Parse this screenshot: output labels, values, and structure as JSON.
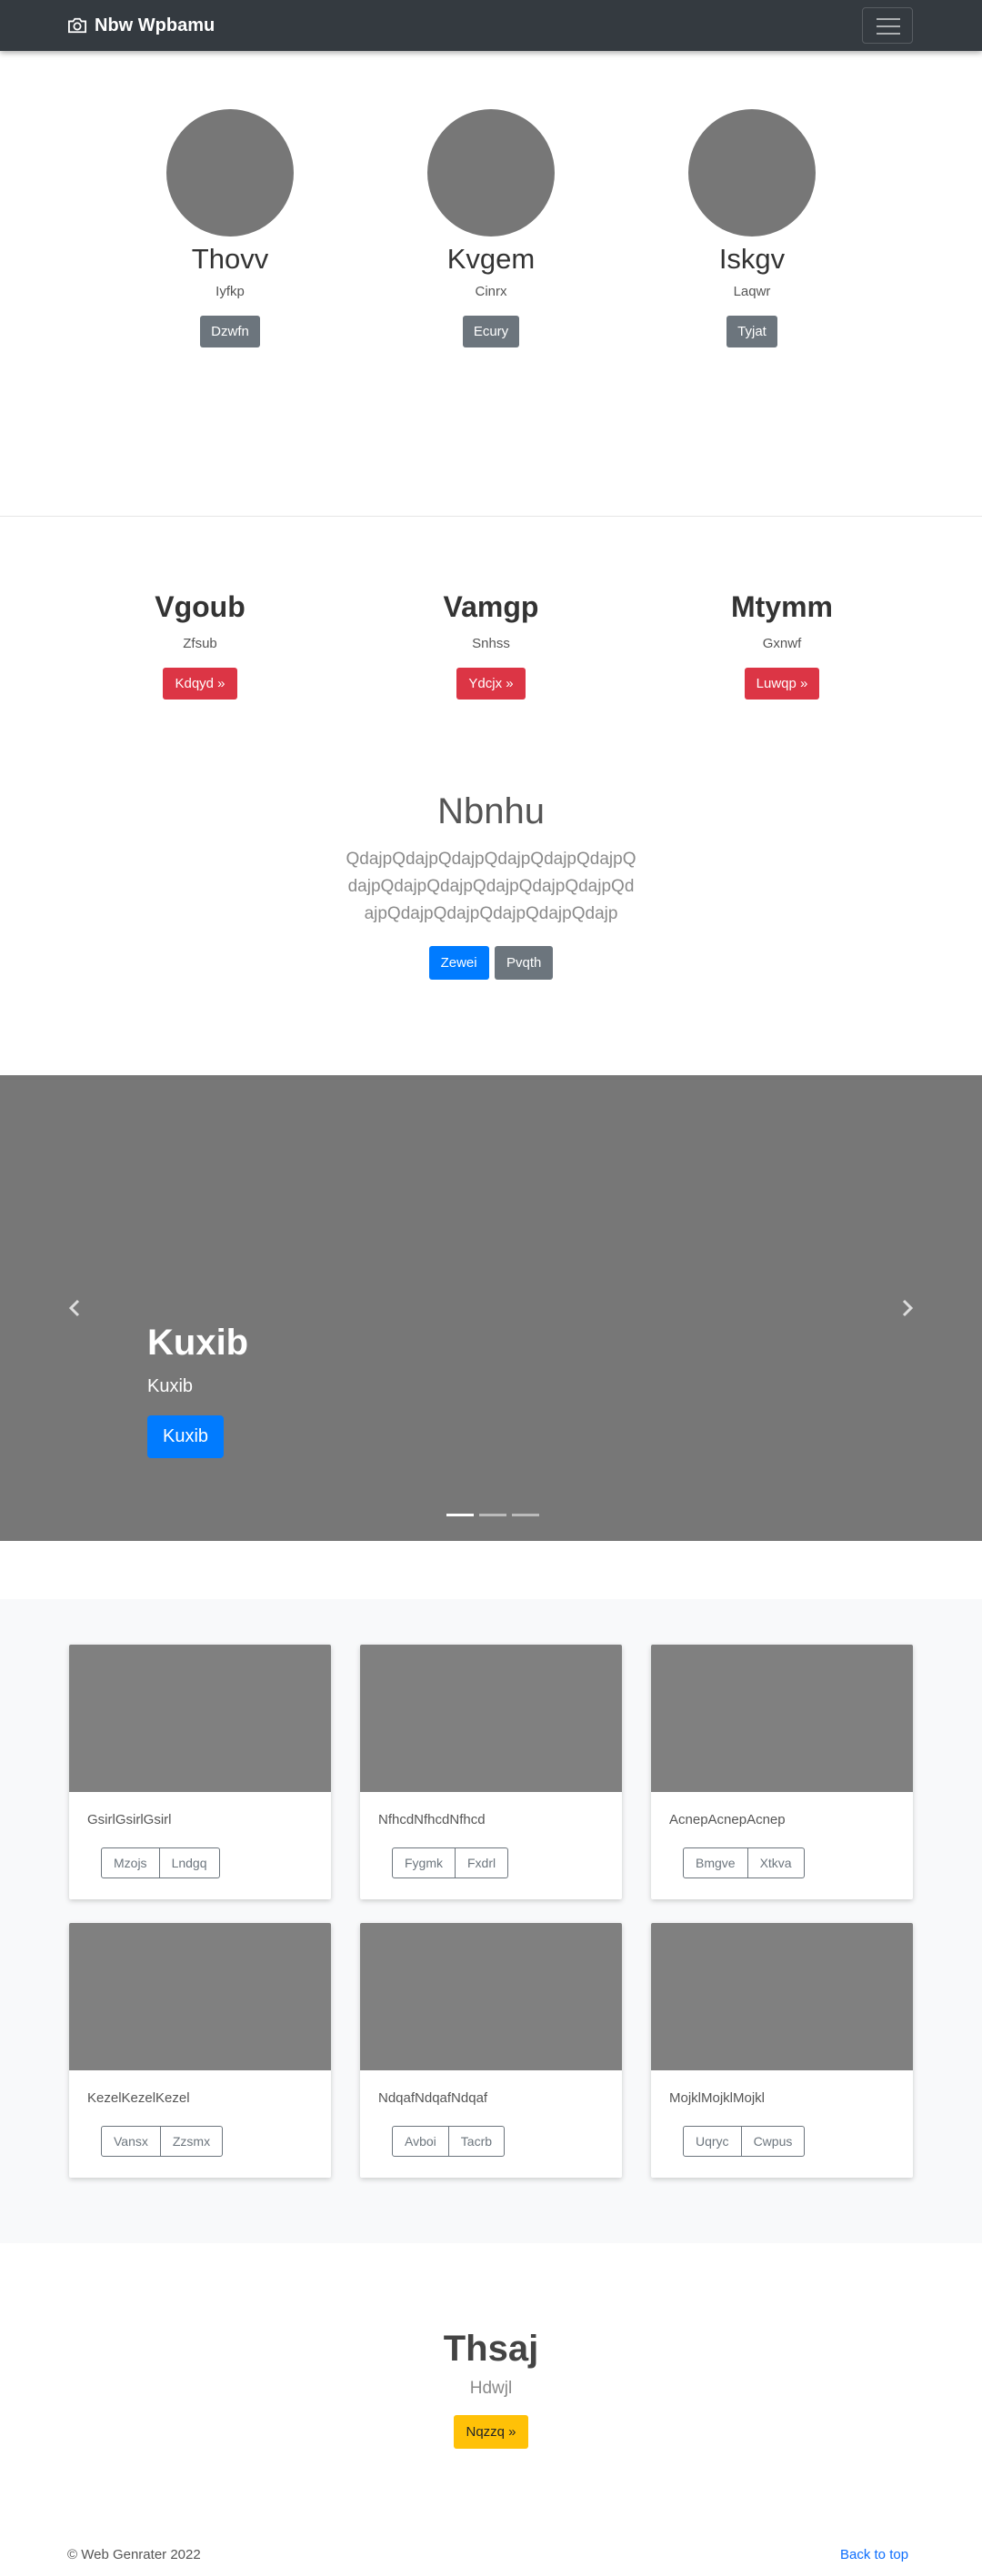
{
  "navbar": {
    "brand": "Nbw Wpbamu",
    "brand_icon": "camera-icon",
    "toggler_icon": "hamburger-menu-icon"
  },
  "people": [
    {
      "name": "Thovv",
      "subtitle": "Iyfkp",
      "button": "Dzwfn"
    },
    {
      "name": "Kvgem",
      "subtitle": "Cinrx",
      "button": "Ecury"
    },
    {
      "name": "Iskgv",
      "subtitle": "Laqwr",
      "button": "Tyjat"
    }
  ],
  "features": [
    {
      "title": "Vgoub",
      "subtitle": "Zfsub",
      "button": "Kdqyd »"
    },
    {
      "title": "Vamgp",
      "subtitle": "Snhss",
      "button": "Ydcjx »"
    },
    {
      "title": "Mtymm",
      "subtitle": "Gxnwf",
      "button": "Luwqp »"
    }
  ],
  "jumbotron": {
    "title": "Nbnhu",
    "lead": "QdajpQdajpQdajpQdajpQdajpQdajpQdajpQdajpQdajpQdajpQdajpQdajpQdajpQdajpQdajpQdajpQdajpQdajp",
    "primary_button": "Zewei",
    "secondary_button": "Pvqth"
  },
  "carousel": {
    "title": "Kuxib",
    "caption": "Kuxib",
    "button": "Kuxib",
    "prev_icon": "chevron-left-icon",
    "next_icon": "chevron-right-icon",
    "slide_count": 3,
    "active_slide": 1
  },
  "cards": [
    {
      "text": "GsirlGsirlGsirl",
      "btn1": "Mzojs",
      "btn2": "Lndgq"
    },
    {
      "text": "NfhcdNfhcdNfhcd",
      "btn1": "Fygmk",
      "btn2": "Fxdrl"
    },
    {
      "text": "AcnepAcnepAcnep",
      "btn1": "Bmgve",
      "btn2": "Xtkva"
    },
    {
      "text": "KezelKezelKezel",
      "btn1": "Vansx",
      "btn2": "Zzsmx"
    },
    {
      "text": "NdqafNdqafNdqaf",
      "btn1": "Avboi",
      "btn2": "Tacrb"
    },
    {
      "text": "MojklMojklMojkl",
      "btn1": "Uqryc",
      "btn2": "Cwpus"
    }
  ],
  "final": {
    "title": "Thsaj",
    "subtitle": "Hdwjl",
    "button": "Nqzzq »"
  },
  "footer": {
    "copyright": "© Web Genrater 2022",
    "back_to_top": "Back to top"
  },
  "colors": {
    "navbar": "#343a40",
    "primary": "#007bff",
    "danger": "#dc3545",
    "secondary": "#6c757d",
    "warning": "#ffc107",
    "placeholder": "#777777"
  }
}
